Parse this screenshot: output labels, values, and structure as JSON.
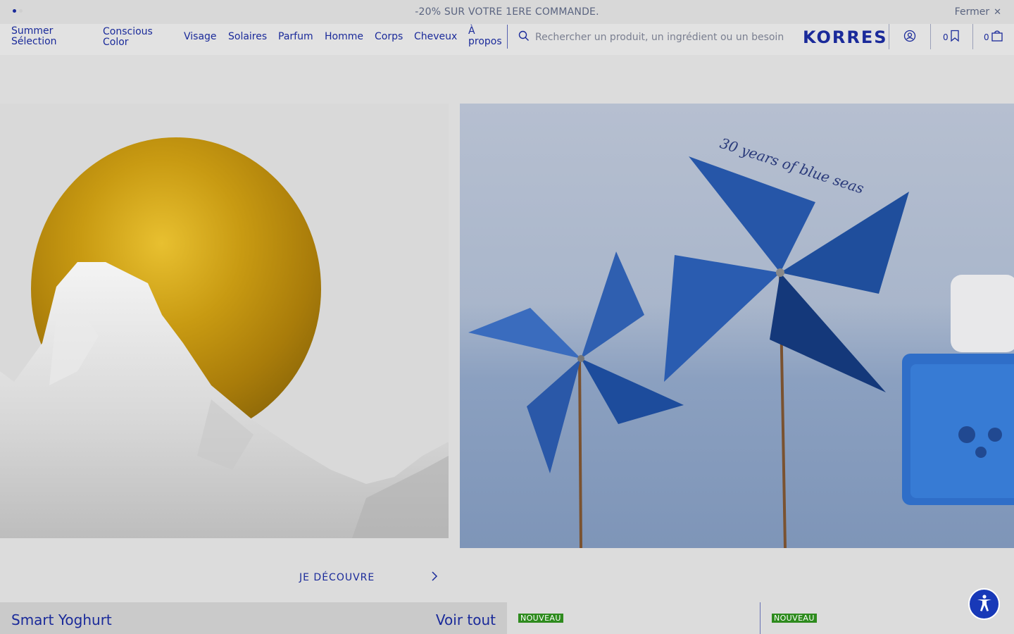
{
  "promo": {
    "text": "-20% SUR VOTRE 1ERE COMMANDE.",
    "close_label": "Fermer",
    "close_icon": "close-icon",
    "slides": 2,
    "active_slide": 1
  },
  "nav": {
    "items": [
      {
        "line1": "Summer",
        "line2": "Sélection"
      },
      {
        "line1": "Conscious",
        "line2": "Color"
      },
      {
        "line1": "Visage",
        "line2": ""
      },
      {
        "line1": "Solaires",
        "line2": ""
      },
      {
        "line1": "Parfum",
        "line2": ""
      },
      {
        "line1": "Homme",
        "line2": ""
      },
      {
        "line1": "Corps",
        "line2": ""
      },
      {
        "line1": "Cheveux",
        "line2": ""
      },
      {
        "line1": "À",
        "line2": "propos"
      }
    ]
  },
  "search": {
    "placeholder": "Rechercher un produit, un ingrédient ou un besoin",
    "icon": "search-icon"
  },
  "brand": {
    "logo": "KORRES",
    "color": "#1a2a9a"
  },
  "header_actions": {
    "account_icon": "account-icon",
    "wishlist_count": "0",
    "wishlist_icon": "bookmark-icon",
    "cart_count": "0",
    "cart_icon": "bag-icon"
  },
  "hero": {
    "right_handwriting": "30 years of blue seas",
    "cta_label": "JE DÉCOUVRE",
    "cta_icon": "chevron-right-icon"
  },
  "products": {
    "section_title": "Smart Yoghurt",
    "see_all": "Voir tout",
    "badges": [
      "NOUVEAU",
      "NOUVEAU"
    ],
    "badge_color": "#2e8b1e"
  },
  "accessibility": {
    "icon": "accessibility-icon",
    "color": "#1839b8"
  }
}
